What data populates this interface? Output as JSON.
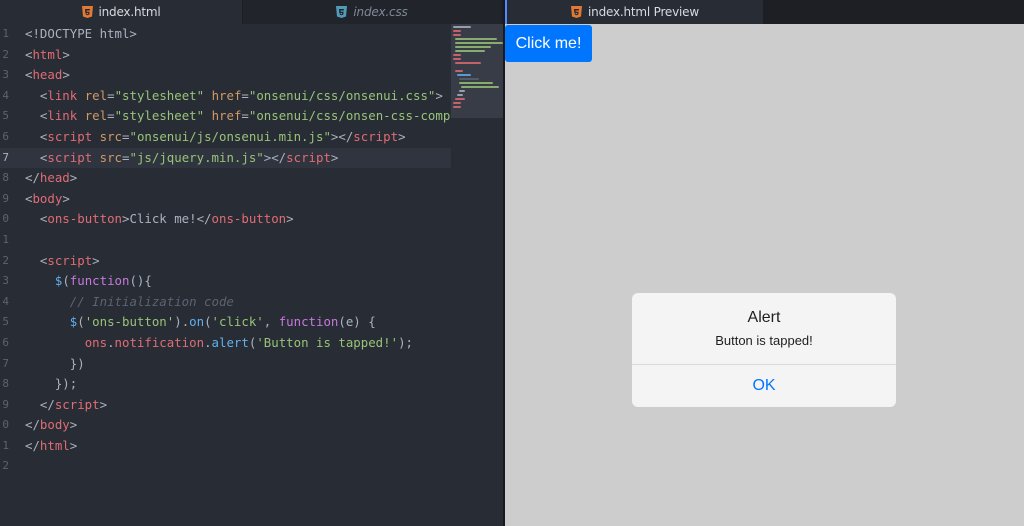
{
  "editor": {
    "tabs": [
      {
        "label": "index.html",
        "icon": "html5-icon"
      },
      {
        "label": "index.css",
        "icon": "css3-icon"
      }
    ],
    "active_line": 7,
    "lines": [
      {
        "n": "1",
        "s": [
          {
            "c": "",
            "t": "<!DOCTYPE html>"
          }
        ]
      },
      {
        "n": "2",
        "s": [
          {
            "c": "",
            "t": "<"
          },
          {
            "c": "tag",
            "t": "html"
          },
          {
            "c": "",
            "t": ">"
          }
        ]
      },
      {
        "n": "3",
        "s": [
          {
            "c": "",
            "t": "<"
          },
          {
            "c": "tag",
            "t": "head"
          },
          {
            "c": "",
            "t": ">"
          }
        ]
      },
      {
        "n": "4",
        "s": [
          {
            "c": "",
            "t": "  <"
          },
          {
            "c": "tag",
            "t": "link"
          },
          {
            "c": "",
            "t": " "
          },
          {
            "c": "attr",
            "t": "rel"
          },
          {
            "c": "",
            "t": "="
          },
          {
            "c": "str",
            "t": "\"stylesheet\""
          },
          {
            "c": "",
            "t": " "
          },
          {
            "c": "attr",
            "t": "href"
          },
          {
            "c": "",
            "t": "="
          },
          {
            "c": "str",
            "t": "\"onsenui/css/onsenui.css\""
          },
          {
            "c": "",
            "t": ">"
          }
        ]
      },
      {
        "n": "5",
        "s": [
          {
            "c": "",
            "t": "  <"
          },
          {
            "c": "tag",
            "t": "link"
          },
          {
            "c": "",
            "t": " "
          },
          {
            "c": "attr",
            "t": "rel"
          },
          {
            "c": "",
            "t": "="
          },
          {
            "c": "str",
            "t": "\"stylesheet\""
          },
          {
            "c": "",
            "t": " "
          },
          {
            "c": "attr",
            "t": "href"
          },
          {
            "c": "",
            "t": "="
          },
          {
            "c": "str",
            "t": "\"onsenui/css/onsen-css-comp"
          }
        ]
      },
      {
        "n": "6",
        "s": [
          {
            "c": "",
            "t": "  <"
          },
          {
            "c": "tag",
            "t": "script"
          },
          {
            "c": "",
            "t": " "
          },
          {
            "c": "attr",
            "t": "src"
          },
          {
            "c": "",
            "t": "="
          },
          {
            "c": "str",
            "t": "\"onsenui/js/onsenui.min.js\""
          },
          {
            "c": "",
            "t": "></"
          },
          {
            "c": "tag",
            "t": "script"
          },
          {
            "c": "",
            "t": ">"
          }
        ]
      },
      {
        "n": "7",
        "s": [
          {
            "c": "",
            "t": "  <"
          },
          {
            "c": "tag",
            "t": "script"
          },
          {
            "c": "",
            "t": " "
          },
          {
            "c": "attr",
            "t": "src"
          },
          {
            "c": "",
            "t": "="
          },
          {
            "c": "str",
            "t": "\"js/jquery.min.js\""
          },
          {
            "c": "",
            "t": "></"
          },
          {
            "c": "tag",
            "t": "script"
          },
          {
            "c": "",
            "t": ">"
          }
        ]
      },
      {
        "n": "8",
        "s": [
          {
            "c": "",
            "t": "</"
          },
          {
            "c": "tag",
            "t": "head"
          },
          {
            "c": "",
            "t": ">"
          }
        ]
      },
      {
        "n": "9",
        "s": [
          {
            "c": "",
            "t": "<"
          },
          {
            "c": "tag",
            "t": "body"
          },
          {
            "c": "",
            "t": ">"
          }
        ]
      },
      {
        "n": "0",
        "s": [
          {
            "c": "",
            "t": "  <"
          },
          {
            "c": "tag",
            "t": "ons-button"
          },
          {
            "c": "",
            "t": ">Click me!</"
          },
          {
            "c": "tag",
            "t": "ons-button"
          },
          {
            "c": "",
            "t": ">"
          }
        ]
      },
      {
        "n": "1",
        "s": [
          {
            "c": "",
            "t": ""
          }
        ]
      },
      {
        "n": "2",
        "s": [
          {
            "c": "",
            "t": "  <"
          },
          {
            "c": "tag",
            "t": "script"
          },
          {
            "c": "",
            "t": ">"
          }
        ]
      },
      {
        "n": "3",
        "s": [
          {
            "c": "",
            "t": "    "
          },
          {
            "c": "fn",
            "t": "$"
          },
          {
            "c": "",
            "t": "("
          },
          {
            "c": "kw",
            "t": "function"
          },
          {
            "c": "",
            "t": "(){"
          }
        ]
      },
      {
        "n": "4",
        "s": [
          {
            "c": "",
            "t": "      "
          },
          {
            "c": "cmt",
            "t": "// Initialization code"
          }
        ]
      },
      {
        "n": "5",
        "s": [
          {
            "c": "",
            "t": "      "
          },
          {
            "c": "fn",
            "t": "$"
          },
          {
            "c": "",
            "t": "("
          },
          {
            "c": "str",
            "t": "'ons-button'"
          },
          {
            "c": "",
            "t": ")."
          },
          {
            "c": "fn",
            "t": "on"
          },
          {
            "c": "",
            "t": "("
          },
          {
            "c": "str",
            "t": "'click'"
          },
          {
            "c": "",
            "t": ", "
          },
          {
            "c": "kw",
            "t": "function"
          },
          {
            "c": "",
            "t": "(e) {"
          }
        ]
      },
      {
        "n": "6",
        "s": [
          {
            "c": "",
            "t": "        "
          },
          {
            "c": "obj",
            "t": "ons"
          },
          {
            "c": "",
            "t": "."
          },
          {
            "c": "obj",
            "t": "notification"
          },
          {
            "c": "",
            "t": "."
          },
          {
            "c": "fn",
            "t": "alert"
          },
          {
            "c": "",
            "t": "("
          },
          {
            "c": "str",
            "t": "'Button is tapped!'"
          },
          {
            "c": "",
            "t": ");"
          }
        ]
      },
      {
        "n": "7",
        "s": [
          {
            "c": "",
            "t": "      })"
          }
        ]
      },
      {
        "n": "8",
        "s": [
          {
            "c": "",
            "t": "    });"
          }
        ]
      },
      {
        "n": "9",
        "s": [
          {
            "c": "",
            "t": "  </"
          },
          {
            "c": "tag",
            "t": "script"
          },
          {
            "c": "",
            "t": ">"
          }
        ]
      },
      {
        "n": "0",
        "s": [
          {
            "c": "",
            "t": "</"
          },
          {
            "c": "tag",
            "t": "body"
          },
          {
            "c": "",
            "t": ">"
          }
        ]
      },
      {
        "n": "1",
        "s": [
          {
            "c": "",
            "t": "</"
          },
          {
            "c": "tag",
            "t": "html"
          },
          {
            "c": "",
            "t": ">"
          }
        ]
      },
      {
        "n": "2",
        "s": [
          {
            "c": "",
            "t": ""
          }
        ]
      }
    ]
  },
  "preview": {
    "tab_label": "index.html Preview",
    "tab_icon": "html5-icon",
    "button_label": "Click me!",
    "alert": {
      "title": "Alert",
      "message": "Button is tapped!",
      "ok_label": "OK"
    }
  },
  "colors": {
    "accent": "#0076ff",
    "editor_bg": "#282c34",
    "preview_bg": "#cdcdcd",
    "html_icon": "#e37933",
    "css_icon": "#519aba"
  }
}
